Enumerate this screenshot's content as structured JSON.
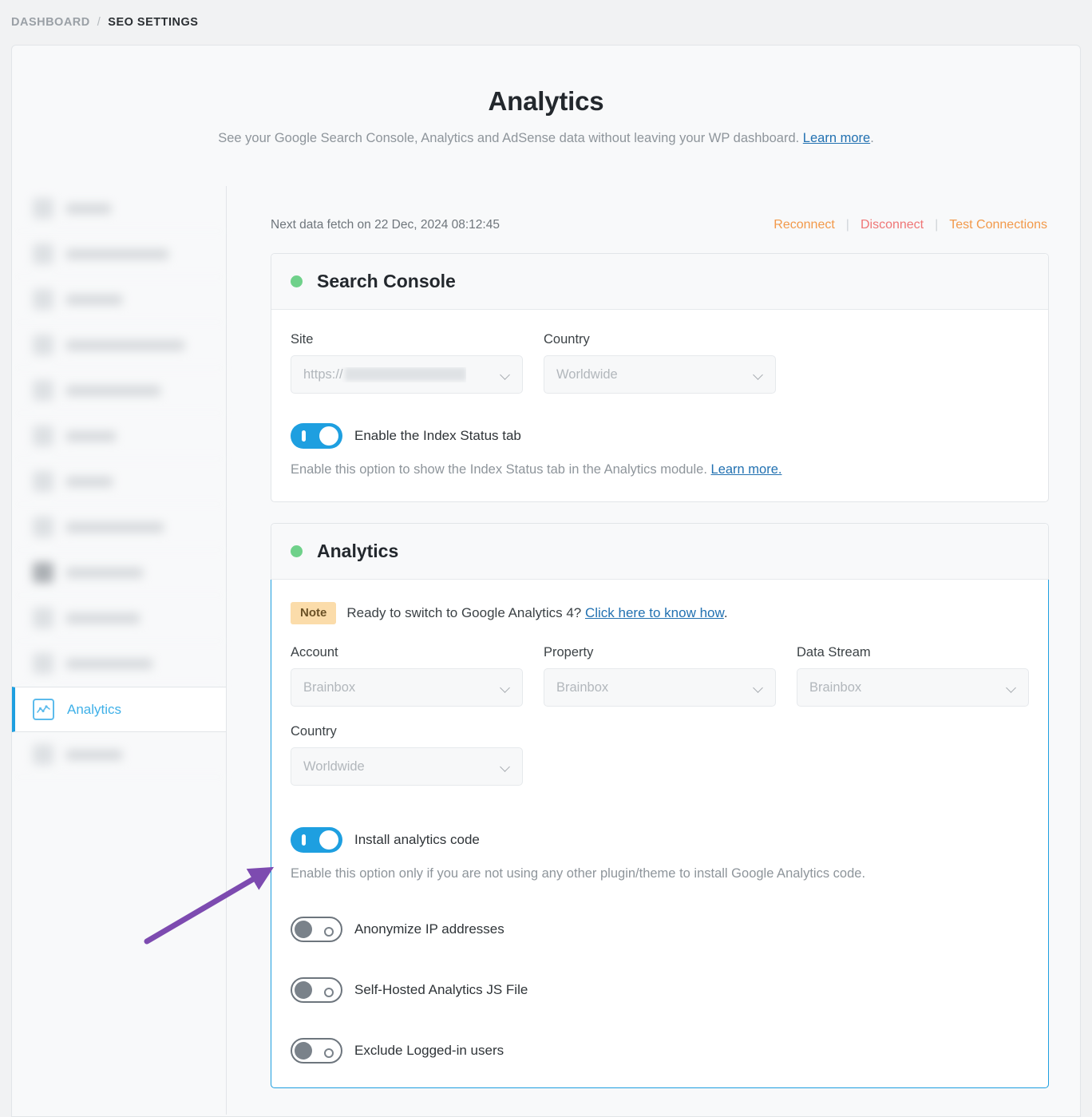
{
  "breadcrumb": {
    "root": "DASHBOARD",
    "separator": "/",
    "current": "SEO SETTINGS"
  },
  "hero": {
    "title": "Analytics",
    "description": "See your Google Search Console, Analytics and AdSense data without leaving your WP dashboard.",
    "learn_more": "Learn more",
    "period": "."
  },
  "sidebar": {
    "active_item": {
      "label": "Analytics",
      "icon": "line-chart-icon",
      "accent_color": "#3eb0e8"
    },
    "blurred_items_count": 12
  },
  "status": {
    "fetch_text": "Next data fetch on 22 Dec, 2024 08:12:45",
    "actions": [
      {
        "label": "Reconnect",
        "color": "#f2994a"
      },
      {
        "label": "Disconnect",
        "color": "#ef7676"
      },
      {
        "label": "Test Connections",
        "color": "#f2994a"
      }
    ],
    "separator": "|"
  },
  "search_console": {
    "title": "Search Console",
    "status_color": "#6fd18a",
    "site": {
      "label": "Site",
      "value_prefix": "https://",
      "value_redacted": true
    },
    "country": {
      "label": "Country",
      "value": "Worldwide"
    },
    "index_status_toggle": {
      "label": "Enable the Index Status tab",
      "state": "on",
      "helper": "Enable this option to show the Index Status tab in the Analytics module.",
      "helper_link": "Learn more."
    }
  },
  "analytics": {
    "title": "Analytics",
    "status_color": "#6fd18a",
    "note": {
      "badge": "Note",
      "text_before": "Ready to switch to Google Analytics 4?",
      "link": "Click here to know how",
      "text_after": "."
    },
    "account": {
      "label": "Account",
      "value": "Brainbox"
    },
    "property": {
      "label": "Property",
      "value": "Brainbox"
    },
    "data_stream": {
      "label": "Data Stream",
      "value": "Brainbox"
    },
    "country": {
      "label": "Country",
      "value": "Worldwide"
    },
    "install_toggle": {
      "label": "Install analytics code",
      "state": "on",
      "helper": "Enable this option only if you are not using any other plugin/theme to install Google Analytics code."
    },
    "toggles": [
      {
        "label": "Anonymize IP addresses",
        "state": "off"
      },
      {
        "label": "Self-Hosted Analytics JS File",
        "state": "off"
      },
      {
        "label": "Exclude Logged-in users",
        "state": "off"
      }
    ]
  },
  "annotation": {
    "arrow_color": "#7d4bb0",
    "points_to": "install-analytics-code-toggle"
  }
}
